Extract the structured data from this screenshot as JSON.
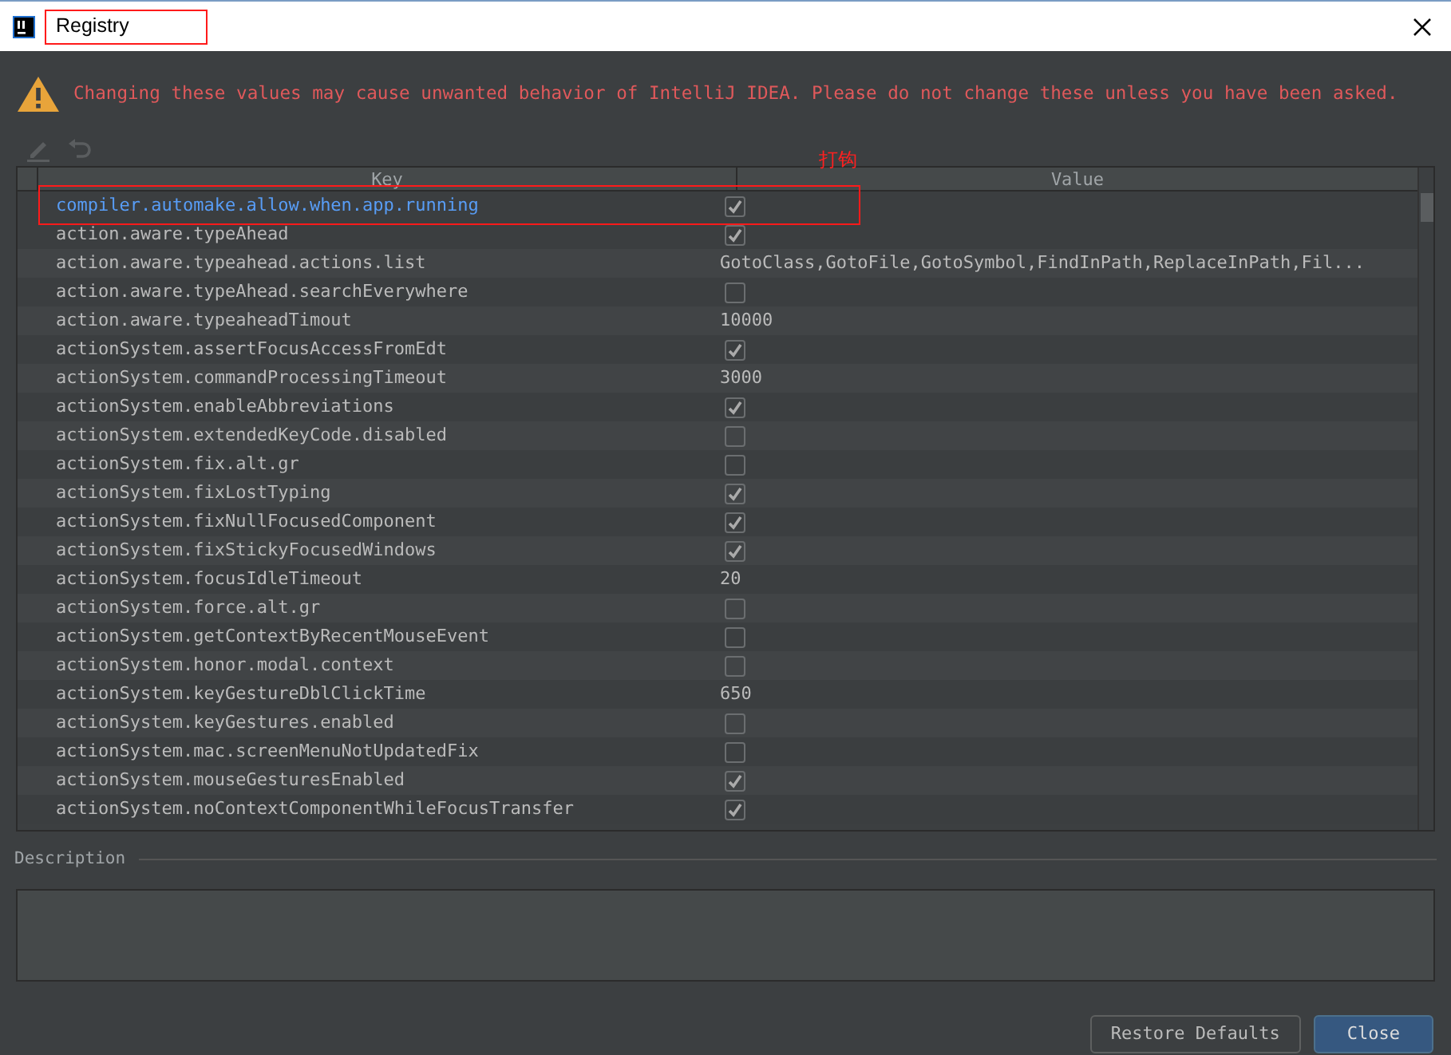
{
  "window": {
    "title": "Registry"
  },
  "warning": "Changing these values may cause unwanted behavior of IntelliJ IDEA. Please do not change these unless you have been asked.",
  "toolbar": [
    {
      "kind": "edit",
      "disabled": true
    },
    {
      "kind": "revert",
      "disabled": true
    }
  ],
  "table": {
    "columns": [
      "Key",
      "Value"
    ],
    "rows": [
      {
        "key": "compiler.automake.allow.when.app.running",
        "kind": "checkbox",
        "checked": true,
        "selected": true
      },
      {
        "key": "action.aware.typeAhead",
        "kind": "checkbox",
        "checked": true,
        "selected": false
      },
      {
        "key": "action.aware.typeahead.actions.list",
        "kind": "text",
        "value": "GotoClass,GotoFile,GotoSymbol,FindInPath,ReplaceInPath,Fil...",
        "selected": false
      },
      {
        "key": "action.aware.typeAhead.searchEverywhere",
        "kind": "checkbox",
        "checked": false,
        "selected": false
      },
      {
        "key": "action.aware.typeaheadTimout",
        "kind": "text",
        "value": "10000",
        "selected": false
      },
      {
        "key": "actionSystem.assertFocusAccessFromEdt",
        "kind": "checkbox",
        "checked": true,
        "selected": false
      },
      {
        "key": "actionSystem.commandProcessingTimeout",
        "kind": "text",
        "value": "3000",
        "selected": false
      },
      {
        "key": "actionSystem.enableAbbreviations",
        "kind": "checkbox",
        "checked": true,
        "selected": false
      },
      {
        "key": "actionSystem.extendedKeyCode.disabled",
        "kind": "checkbox",
        "checked": false,
        "selected": false
      },
      {
        "key": "actionSystem.fix.alt.gr",
        "kind": "checkbox",
        "checked": false,
        "selected": false
      },
      {
        "key": "actionSystem.fixLostTyping",
        "kind": "checkbox",
        "checked": true,
        "selected": false
      },
      {
        "key": "actionSystem.fixNullFocusedComponent",
        "kind": "checkbox",
        "checked": true,
        "selected": false
      },
      {
        "key": "actionSystem.fixStickyFocusedWindows",
        "kind": "checkbox",
        "checked": true,
        "selected": false
      },
      {
        "key": "actionSystem.focusIdleTimeout",
        "kind": "text",
        "value": "20",
        "selected": false
      },
      {
        "key": "actionSystem.force.alt.gr",
        "kind": "checkbox",
        "checked": false,
        "selected": false
      },
      {
        "key": "actionSystem.getContextByRecentMouseEvent",
        "kind": "checkbox",
        "checked": false,
        "selected": false
      },
      {
        "key": "actionSystem.honor.modal.context",
        "kind": "checkbox",
        "checked": false,
        "selected": false
      },
      {
        "key": "actionSystem.keyGestureDblClickTime",
        "kind": "text",
        "value": "650",
        "selected": false
      },
      {
        "key": "actionSystem.keyGestures.enabled",
        "kind": "checkbox",
        "checked": false,
        "selected": false
      },
      {
        "key": "actionSystem.mac.screenMenuNotUpdatedFix",
        "kind": "checkbox",
        "checked": false,
        "selected": false
      },
      {
        "key": "actionSystem.mouseGesturesEnabled",
        "kind": "checkbox",
        "checked": true,
        "selected": false
      },
      {
        "key": "actionSystem.noContextComponentWhileFocusTransfer",
        "kind": "checkbox",
        "checked": true,
        "selected": false
      }
    ]
  },
  "description": {
    "label": "Description"
  },
  "buttons": [
    {
      "label": "Restore Defaults",
      "primary": false
    },
    {
      "label": "Close",
      "primary": true
    }
  ],
  "annotation": {
    "note": "打钩"
  }
}
